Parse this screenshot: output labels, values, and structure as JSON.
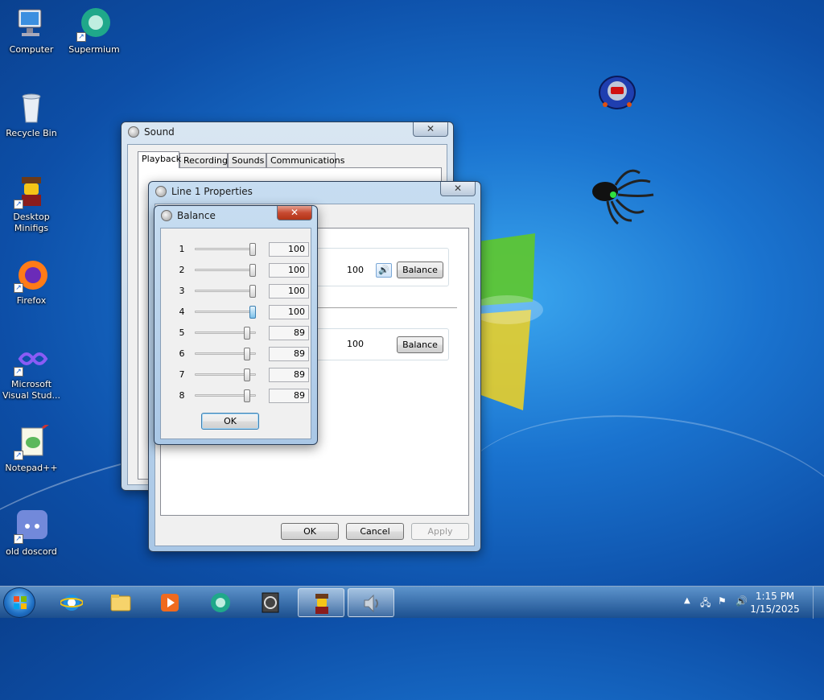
{
  "desktop": {
    "icons": [
      {
        "label": "Computer",
        "icon": "computer-icon"
      },
      {
        "label": "Supermium",
        "icon": "supermium-icon"
      },
      {
        "label": "Recycle Bin",
        "icon": "recycle-bin-icon"
      },
      {
        "label": "Desktop Minifigs",
        "icon": "minifig-icon"
      },
      {
        "label": "Firefox",
        "icon": "firefox-icon"
      },
      {
        "label": "Microsoft Visual Stud...",
        "icon": "visual-studio-icon"
      },
      {
        "label": "Notepad++",
        "icon": "notepadpp-icon"
      },
      {
        "label": "old doscord",
        "icon": "discord-icon"
      }
    ]
  },
  "sound_window": {
    "title": "Sound",
    "tabs": [
      "Playback",
      "Recording",
      "Sounds",
      "Communications"
    ],
    "selected_tab": "Playback"
  },
  "properties_window": {
    "title": "Line 1 Properties",
    "level_value_1": "100",
    "level_value_2": "100",
    "balance_label": "Balance",
    "ok_label": "OK",
    "cancel_label": "Cancel",
    "apply_label": "Apply"
  },
  "balance_dialog": {
    "title": "Balance",
    "channels": [
      {
        "label": "1",
        "value": "100"
      },
      {
        "label": "2",
        "value": "100"
      },
      {
        "label": "3",
        "value": "100"
      },
      {
        "label": "4",
        "value": "100"
      },
      {
        "label": "5",
        "value": "89"
      },
      {
        "label": "6",
        "value": "89"
      },
      {
        "label": "7",
        "value": "89"
      },
      {
        "label": "8",
        "value": "89"
      }
    ],
    "ok_label": "OK",
    "close_glyph": "✕"
  },
  "taskbar": {
    "items": [
      "internet-explorer-icon",
      "explorer-folder-icon",
      "media-player-icon",
      "supermium-icon",
      "winrar-icon",
      "minifig-icon",
      "speaker-icon"
    ],
    "active_item": "speaker-icon",
    "clock_time": "1:15 PM",
    "clock_date": "1/15/2025"
  },
  "colors": {
    "accent": "#1a73cf",
    "close_red": "#c74a31",
    "slider_hot": "#7cc1ea"
  }
}
